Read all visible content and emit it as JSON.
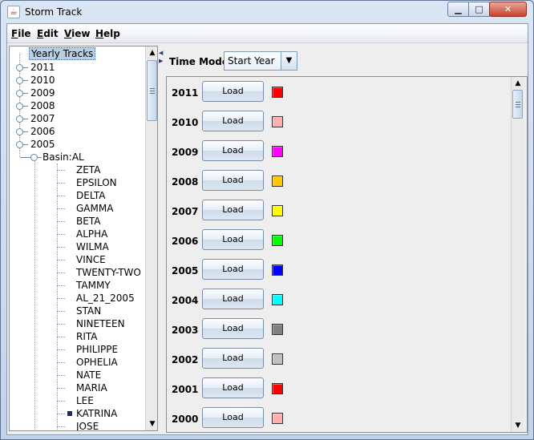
{
  "window": {
    "title": "Storm Track",
    "icon": "java-app-icon",
    "controls": {
      "minimize": "minimize-icon",
      "maximize": "maximize-icon",
      "close": "close-icon"
    }
  },
  "menubar": {
    "items": [
      {
        "label": "File",
        "mnemonic": "F",
        "rest": "ile"
      },
      {
        "label": "Edit",
        "mnemonic": "E",
        "rest": "dit"
      },
      {
        "label": "View",
        "mnemonic": "V",
        "rest": "iew"
      },
      {
        "label": "Help",
        "mnemonic": "H",
        "rest": "elp"
      }
    ]
  },
  "tree": {
    "root": "Yearly Tracks",
    "years": [
      "2011",
      "2010",
      "2009",
      "2008",
      "2007",
      "2006",
      "2005"
    ],
    "expanded_year": "2005",
    "basin": "Basin:AL",
    "storms": [
      "ZETA",
      "EPSILON",
      "DELTA",
      "GAMMA",
      "BETA",
      "ALPHA",
      "WILMA",
      "VINCE",
      "TWENTY-TWO",
      "TAMMY",
      "AL_21_2005",
      "STAN",
      "NINETEEN",
      "RITA",
      "PHILIPPE",
      "OPHELIA",
      "NATE",
      "MARIA",
      "LEE",
      "KATRINA",
      "JOSE"
    ],
    "marked_storm": "KATRINA"
  },
  "time_mode": {
    "label": "Time Mode:",
    "selected": "Start Year"
  },
  "years_panel": {
    "button_label": "Load",
    "rows": [
      {
        "year": "2011",
        "color": "#ff0000"
      },
      {
        "year": "2010",
        "color": "#ffafaf"
      },
      {
        "year": "2009",
        "color": "#ff00ff"
      },
      {
        "year": "2008",
        "color": "#ffc800"
      },
      {
        "year": "2007",
        "color": "#ffff00"
      },
      {
        "year": "2006",
        "color": "#00ff00"
      },
      {
        "year": "2005",
        "color": "#0000ff"
      },
      {
        "year": "2004",
        "color": "#00ffff"
      },
      {
        "year": "2003",
        "color": "#808080"
      },
      {
        "year": "2002",
        "color": "#c0c0c0"
      },
      {
        "year": "2001",
        "color": "#ff0000"
      },
      {
        "year": "2000",
        "color": "#ffafaf"
      }
    ]
  }
}
